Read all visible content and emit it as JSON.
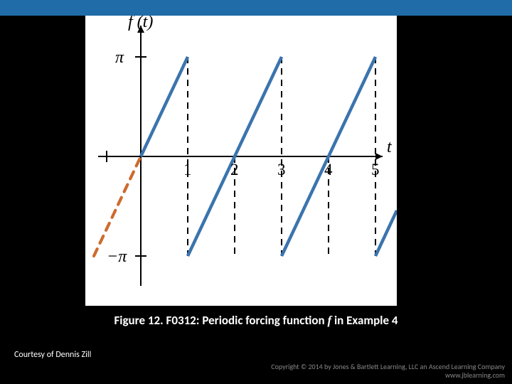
{
  "caption_prefix": "Figure 12. F0312: Periodic forcing function ",
  "caption_var": "f",
  "caption_suffix": " in Example 4",
  "courtesy": "Courtesy of Dennis Zill",
  "copyright_line1": "Copyright © 2014 by Jones & Bartlett Learning, LLC an Ascend Learning Company",
  "copyright_line2": "www.jblearning.com",
  "axis_y_label": "f (t)",
  "axis_x_label": "t",
  "ytick_top": "π",
  "ytick_bottom": "−π",
  "xticks": [
    "1",
    "2",
    "3",
    "4",
    "5"
  ],
  "chart_data": {
    "type": "line",
    "title": "",
    "xlabel": "t",
    "ylabel": "f(t)",
    "xlim": [
      0,
      5.5
    ],
    "ylim": [
      -3.1416,
      3.1416
    ],
    "period": 2,
    "segments": [
      {
        "start": [
          -1,
          -3.1416
        ],
        "end": [
          1,
          3.1416
        ],
        "style": "dashed-then-solid",
        "note": "dashed for t<0, solid for t>=0"
      },
      {
        "start": [
          1,
          -3.1416
        ],
        "end": [
          3,
          3.1416
        ],
        "style": "solid"
      },
      {
        "start": [
          3,
          -3.1416
        ],
        "end": [
          5,
          3.1416
        ],
        "style": "solid"
      },
      {
        "start": [
          5,
          -3.1416
        ],
        "end": [
          5.5,
          -1.5708
        ],
        "style": "solid"
      }
    ],
    "yticks": [
      -3.1416,
      3.1416
    ],
    "ytick_labels": [
      "−π",
      "π"
    ],
    "xticks": [
      1,
      2,
      3,
      4,
      5
    ]
  }
}
